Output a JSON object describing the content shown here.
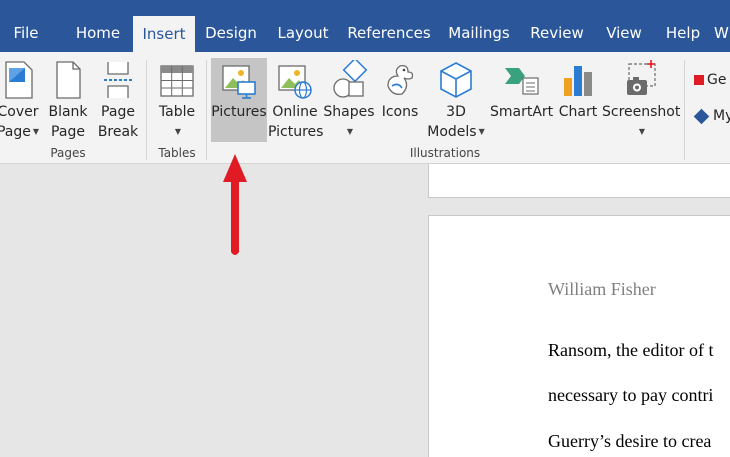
{
  "menu": {
    "tabs": [
      {
        "label": "File"
      },
      {
        "label": "Home"
      },
      {
        "label": "Insert"
      },
      {
        "label": "Design"
      },
      {
        "label": "Layout"
      },
      {
        "label": "References"
      },
      {
        "label": "Mailings"
      },
      {
        "label": "Review"
      },
      {
        "label": "View"
      },
      {
        "label": "Help"
      },
      {
        "label": "W"
      }
    ],
    "active_tab": "Insert"
  },
  "ribbon": {
    "groups": {
      "pages": "Pages",
      "tables": "Tables",
      "illustrations": "Illustrations"
    },
    "buttons": {
      "cover_page": {
        "line1": "Cover",
        "line2": "Page"
      },
      "blank_page": {
        "line1": "Blank",
        "line2": "Page"
      },
      "page_break": {
        "line1": "Page",
        "line2": "Break"
      },
      "table": {
        "line1": "Table"
      },
      "pictures": {
        "line1": "Pictures"
      },
      "online_pictures": {
        "line1": "Online",
        "line2": "Pictures"
      },
      "shapes": {
        "line1": "Shapes"
      },
      "icons": {
        "line1": "Icons"
      },
      "models_3d": {
        "line1": "3D",
        "line2": "Models"
      },
      "smartart": {
        "line1": "SmartArt"
      },
      "chart": {
        "line1": "Chart"
      },
      "screenshot": {
        "line1": "Screenshot"
      }
    },
    "side": {
      "get_addins": "Ge",
      "my_addins": "My"
    }
  },
  "document": {
    "author": "William Fisher",
    "lines": [
      "Ransom, the editor of t",
      "necessary to pay contri",
      "Guerry’s desire to crea"
    ]
  },
  "colors": {
    "title_bar": "#2b579a",
    "ribbon_bg": "#f3f3f3",
    "selected_button": "#c5c5c5",
    "arrow": "#e01b24"
  }
}
